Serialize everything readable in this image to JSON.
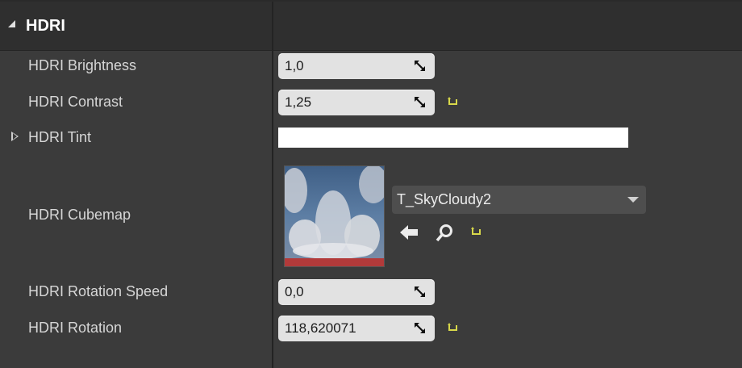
{
  "section": {
    "title": "HDRI"
  },
  "rows": {
    "brightness": {
      "label": "HDRI Brightness",
      "value": "1,0"
    },
    "contrast": {
      "label": "HDRI Contrast",
      "value": "1,25"
    },
    "tint": {
      "label": "HDRI Tint",
      "color": "#ffffff"
    },
    "cubemap": {
      "label": "HDRI Cubemap",
      "asset": "T_SkyCloudy2"
    },
    "rotation_speed": {
      "label": "HDRI Rotation Speed",
      "value": "0,0"
    },
    "rotation": {
      "label": "HDRI Rotation",
      "value": "118,620071"
    }
  },
  "icons": {
    "drag": "drag-handle-icon",
    "reset": "reset-to-default-icon",
    "use_selected": "arrow-left-icon",
    "browse": "magnifier-icon",
    "expand": "triangle-right-icon",
    "collapse": "triangle-down-icon"
  },
  "colors": {
    "accent_reset": "#d8d84a",
    "panel_bg": "#3b3b3b",
    "header_bg": "#2f2f2f",
    "field_bg": "#e2e2e2"
  }
}
